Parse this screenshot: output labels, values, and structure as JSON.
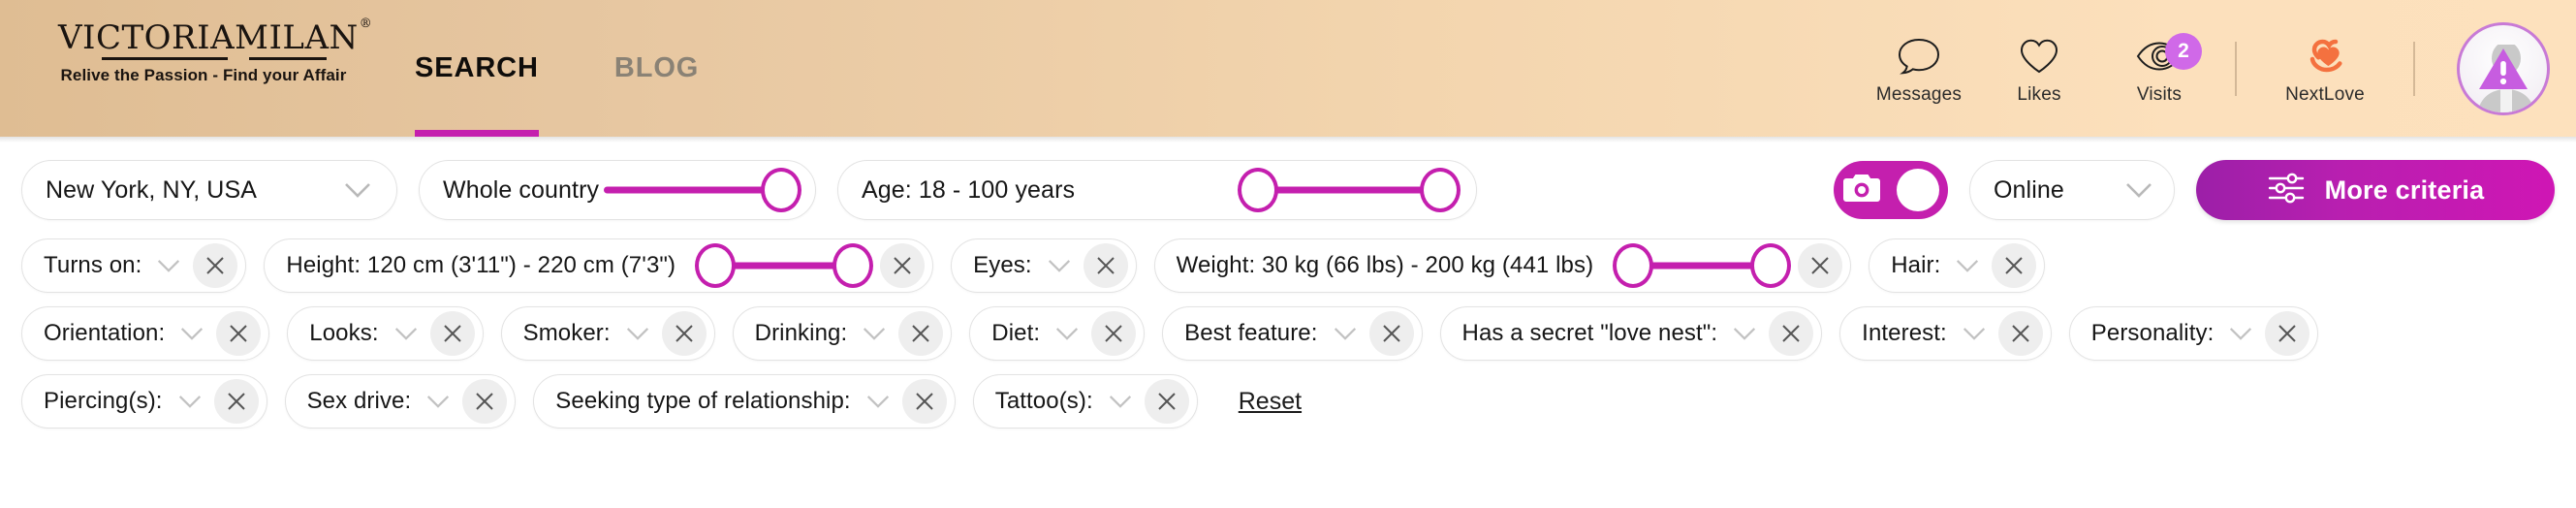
{
  "brand": {
    "logo_text": "VICTORIAMILAN",
    "logo_registered": "®",
    "tagline": "Relive the Passion - Find your Affair"
  },
  "nav": {
    "tabs": [
      {
        "label": "SEARCH",
        "active": true
      },
      {
        "label": "BLOG",
        "active": false
      }
    ],
    "right_items": [
      {
        "label": "Messages",
        "icon": "speech-bubble-icon",
        "badge": null
      },
      {
        "label": "Likes",
        "icon": "heart-icon",
        "badge": null
      },
      {
        "label": "Visits",
        "icon": "eye-icon",
        "badge": "2"
      }
    ],
    "nextlove": {
      "label": "NextLove",
      "icon": "double-heart-icon"
    },
    "avatar": {
      "alt": "profile-avatar",
      "warning": "!"
    }
  },
  "colors": {
    "accent_magenta": "#c41fae",
    "badge_purple": "#d069e8",
    "header_gradient_start": "#dfbd93",
    "header_gradient_end": "#fde1bc",
    "nextlove_orange": "#f4713f"
  },
  "filters": {
    "row1": {
      "location": {
        "value": "New York, NY, USA",
        "icon": "chevron-down-icon"
      },
      "country": {
        "label": "Whole country",
        "slider": "single-max"
      },
      "age": {
        "label": "Age: 18 - 100 years",
        "slider": "range",
        "min": 18,
        "max": 100
      },
      "photo_toggle": {
        "icon": "camera-icon",
        "state": "on"
      },
      "online": {
        "value": "Online",
        "icon": "chevron-down-icon"
      },
      "more_criteria": {
        "label": "More criteria",
        "icon": "sliders-icon"
      }
    },
    "row2": [
      {
        "label": "Turns on:",
        "type": "dropdown"
      },
      {
        "label": "Height: 120 cm (3'11\") - 220 cm (7'3\")",
        "type": "range"
      },
      {
        "label": "Eyes:",
        "type": "dropdown"
      },
      {
        "label": "Weight: 30 kg (66 lbs) - 200 kg (441 lbs)",
        "type": "range"
      },
      {
        "label": "Hair:",
        "type": "dropdown"
      }
    ],
    "row3": [
      {
        "label": "Orientation:",
        "type": "dropdown"
      },
      {
        "label": "Looks:",
        "type": "dropdown"
      },
      {
        "label": "Smoker:",
        "type": "dropdown"
      },
      {
        "label": "Drinking:",
        "type": "dropdown"
      },
      {
        "label": "Diet:",
        "type": "dropdown"
      },
      {
        "label": "Best feature:",
        "type": "dropdown"
      },
      {
        "label": "Has a secret \"love nest\":",
        "type": "dropdown"
      },
      {
        "label": "Interest:",
        "type": "dropdown"
      },
      {
        "label": "Personality:",
        "type": "dropdown"
      }
    ],
    "row4": [
      {
        "label": "Piercing(s):",
        "type": "dropdown"
      },
      {
        "label": "Sex drive:",
        "type": "dropdown"
      },
      {
        "label": "Seeking type of relationship:",
        "type": "dropdown"
      },
      {
        "label": "Tattoo(s):",
        "type": "dropdown"
      }
    ],
    "reset": {
      "label": "Reset"
    }
  }
}
